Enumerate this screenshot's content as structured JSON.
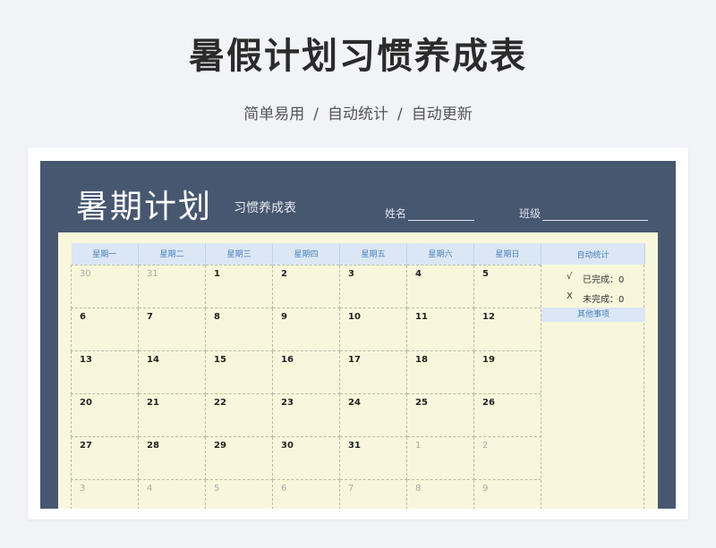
{
  "hero": {
    "title": "暑假计划习惯养成表",
    "sub_items": [
      "简单易用",
      "自动统计",
      "自动更新"
    ],
    "separator": "/"
  },
  "sheet": {
    "title": "暑期计划",
    "subtitle": "习惯养成表",
    "name_label": "姓名",
    "class_label": "班级"
  },
  "calendar": {
    "weekdays": [
      "星期一",
      "星期二",
      "星期三",
      "星期四",
      "星期五",
      "星期六",
      "星期日"
    ],
    "stats_header": "自动统计",
    "weeks": [
      [
        {
          "d": "30",
          "m": true
        },
        {
          "d": "31",
          "m": true
        },
        {
          "d": "1"
        },
        {
          "d": "2"
        },
        {
          "d": "3"
        },
        {
          "d": "4"
        },
        {
          "d": "5"
        }
      ],
      [
        {
          "d": "6"
        },
        {
          "d": "7"
        },
        {
          "d": "8"
        },
        {
          "d": "9"
        },
        {
          "d": "10"
        },
        {
          "d": "11"
        },
        {
          "d": "12"
        }
      ],
      [
        {
          "d": "13"
        },
        {
          "d": "14"
        },
        {
          "d": "15"
        },
        {
          "d": "16"
        },
        {
          "d": "17"
        },
        {
          "d": "18"
        },
        {
          "d": "19"
        }
      ],
      [
        {
          "d": "20"
        },
        {
          "d": "21"
        },
        {
          "d": "22"
        },
        {
          "d": "23"
        },
        {
          "d": "24"
        },
        {
          "d": "25"
        },
        {
          "d": "26"
        }
      ],
      [
        {
          "d": "27"
        },
        {
          "d": "28"
        },
        {
          "d": "29"
        },
        {
          "d": "30"
        },
        {
          "d": "31"
        },
        {
          "d": "1",
          "m": true
        },
        {
          "d": "2",
          "m": true
        }
      ],
      [
        {
          "d": "3",
          "m": true
        },
        {
          "d": "4",
          "m": true
        },
        {
          "d": "5",
          "m": true
        },
        {
          "d": "6",
          "m": true
        },
        {
          "d": "7",
          "m": true
        },
        {
          "d": "8",
          "m": true
        },
        {
          "d": "9",
          "m": true
        }
      ]
    ]
  },
  "stats": {
    "done_mark": "√",
    "done_label": "已完成：0",
    "undone_mark": "X",
    "undone_label": "未完成：0",
    "other_label": "其他事项"
  },
  "colors": {
    "sheet_bg": "#485770",
    "calendar_bg": "#f8f7dc",
    "header_bg": "#dbe7f5",
    "header_text": "#4a7fb8"
  }
}
